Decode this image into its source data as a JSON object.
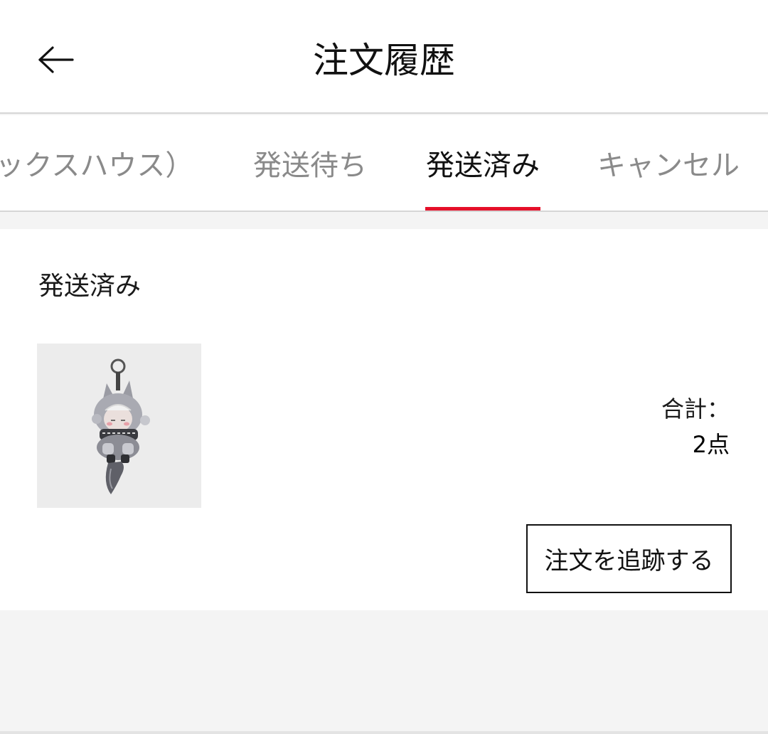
{
  "header": {
    "title": "注文履歴",
    "back_icon": "arrow-left-icon"
  },
  "tabs": [
    {
      "label": "ックスハウス）",
      "active": false
    },
    {
      "label": "発送待ち",
      "active": false
    },
    {
      "label": "発送済み",
      "active": true
    },
    {
      "label": "キャンセル",
      "active": false
    }
  ],
  "order": {
    "status": "発送済み",
    "total_label": "合計：",
    "total_count": "2点",
    "track_button": "注文を追跡する",
    "product_image_icon": "figure-keychain-image"
  },
  "colors": {
    "accent": "#e5102a",
    "active_tab": "#111111",
    "inactive_tab": "#8a8a8a",
    "background": "#f4f4f4"
  }
}
